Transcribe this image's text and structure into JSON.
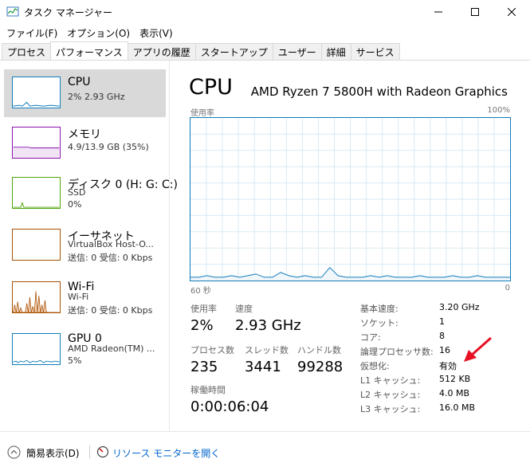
{
  "window": {
    "title": "タスク マネージャー",
    "menu": [
      "ファイル(F)",
      "オプション(O)",
      "表示(V)"
    ],
    "tabs": [
      "プロセス",
      "パフォーマンス",
      "アプリの履歴",
      "スタートアップ",
      "ユーザー",
      "詳細",
      "サービス"
    ]
  },
  "sidebar": [
    {
      "name": "CPU",
      "sub1": "2%  2.93 GHz",
      "color": "#117dbb"
    },
    {
      "name": "メモリ",
      "sub1": "4.9/13.9 GB (35%)",
      "color": "#8b12ae"
    },
    {
      "name": "ディスク 0 (H: G: C:)",
      "sub1": "SSD",
      "sub2": "0%",
      "color": "#4da60c"
    },
    {
      "name": "イーサネット",
      "sub1": "VirtualBox Host-O...",
      "sub2": "送信: 0  受信: 0 Kbps",
      "color": "#a74f01"
    },
    {
      "name": "Wi-Fi",
      "sub1": "Wi-Fi",
      "sub2": "送信: 0  受信: 0 Kbps",
      "color": "#a74f01"
    },
    {
      "name": "GPU 0",
      "sub1": "AMD Radeon(TM) ...",
      "sub2": "5%",
      "color": "#117dbb"
    }
  ],
  "main": {
    "title": "CPU",
    "model": "AMD Ryzen 7 5800H with Radeon Graphics",
    "axis_top_left": "使用率",
    "axis_top_right": "100%",
    "axis_bottom_left": "60 秒",
    "axis_bottom_right": "0",
    "stats": {
      "usage_label": "使用率",
      "usage_value": "2%",
      "speed_label": "速度",
      "speed_value": "2.93 GHz",
      "proc_label": "プロセス数",
      "proc_value": "235",
      "thread_label": "スレッド数",
      "thread_value": "3441",
      "handle_label": "ハンドル数",
      "handle_value": "99288",
      "uptime_label": "稼働時間",
      "uptime_value": "0:00:06:04"
    },
    "specs": [
      {
        "label": "基本速度:",
        "value": "3.20 GHz"
      },
      {
        "label": "ソケット:",
        "value": "1"
      },
      {
        "label": "コア:",
        "value": "8"
      },
      {
        "label": "論理プロセッサ数:",
        "value": "16"
      },
      {
        "label": "仮想化:",
        "value": "有効"
      },
      {
        "label": "L1 キャッシュ:",
        "value": "512 KB"
      },
      {
        "label": "L2 キャッシュ:",
        "value": "4.0 MB"
      },
      {
        "label": "L3 キャッシュ:",
        "value": "16.0 MB"
      }
    ],
    "usage_history_pct": [
      2,
      2,
      3,
      2,
      2,
      3,
      2,
      3,
      4,
      2,
      2,
      5,
      3,
      2,
      3,
      2,
      2,
      8,
      3,
      2,
      2,
      2,
      3,
      2,
      3,
      2,
      2,
      2,
      3,
      2,
      2,
      2,
      3,
      2,
      2,
      3,
      2,
      2,
      2,
      2
    ]
  },
  "footer": {
    "fewer_details": "簡易表示(D)",
    "resource_monitor": "リソース モニターを開く"
  },
  "colors": {
    "cpu": "#117dbb",
    "arrow": "#e81123"
  }
}
